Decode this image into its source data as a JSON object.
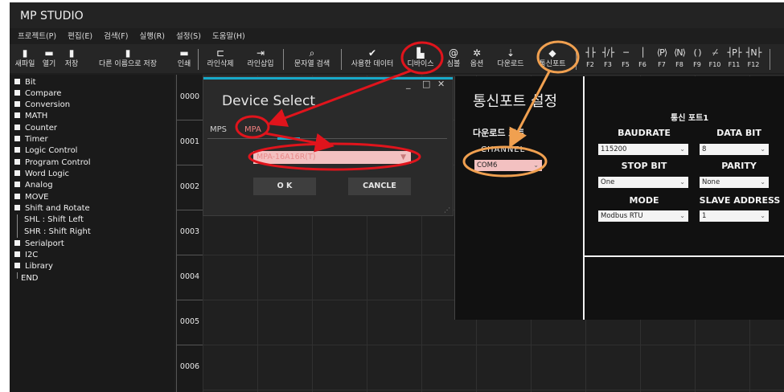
{
  "app": {
    "title": "MP STUDIO"
  },
  "menu": [
    "프로젝트(P)",
    "편집(E)",
    "검색(F)",
    "실행(R)",
    "설정(S)",
    "도움말(H)"
  ],
  "toolbar": {
    "buttons": [
      {
        "label": "새파일",
        "icon": "new-file-icon"
      },
      {
        "label": "열기",
        "icon": "open-folder-icon"
      },
      {
        "label": "저장",
        "icon": "save-icon"
      },
      {
        "label": "다른 이름으로 저장",
        "icon": "save-as-icon"
      },
      {
        "label": "인쇄",
        "icon": "print-icon"
      },
      {
        "label": "라인삭제",
        "icon": "delete-line-icon"
      },
      {
        "label": "라인삽입",
        "icon": "insert-line-icon"
      },
      {
        "label": "문자열 검색",
        "icon": "search-icon"
      },
      {
        "label": "사용한 데이터",
        "icon": "check-icon"
      },
      {
        "label": "디바이스",
        "icon": "device-icon"
      },
      {
        "label": "심볼",
        "icon": "at-symbol-icon"
      },
      {
        "label": "옵션",
        "icon": "gear-icon"
      },
      {
        "label": "다운로드",
        "icon": "download-icon"
      },
      {
        "label": "통신포트",
        "icon": "comm-port-icon"
      }
    ],
    "fkeys": [
      "F2",
      "F3",
      "F5",
      "F6",
      "F7",
      "F8",
      "F9",
      "F10",
      "F11",
      "F12"
    ]
  },
  "tree": {
    "items": [
      "Bit",
      "Compare",
      "Conversion",
      "MATH",
      "Counter",
      "Timer",
      "Logic Control",
      "Program Control",
      "Word Logic",
      "Analog",
      "MOVE",
      "Shift and Rotate"
    ],
    "sub_items": [
      "SHL : Shift Left",
      "SHR : Shift Right"
    ],
    "items2": [
      "Serialport",
      "I2C",
      "Library"
    ],
    "end": "END"
  },
  "rungs": [
    "0000",
    "0001",
    "0002",
    "0003",
    "0004",
    "0005",
    "0006"
  ],
  "device_dialog": {
    "title": "Device Select",
    "controls": {
      "minimize": "_",
      "maximize": "□",
      "close": "✕"
    },
    "tabs": [
      "MPS",
      "MPA"
    ],
    "selected_tab": "MPA",
    "device_value": "MPA-16A16R(T)",
    "ok_label": "O K",
    "cancel_label": "CANCLE"
  },
  "comm_panel": {
    "title": "통신포트 설정",
    "download_port_label": "다운로드 포트",
    "channel_label": "CHANNEL",
    "channel_value": "COM6",
    "section_title": "통신 포트1",
    "baudrate_label": "BAUDRATE",
    "baudrate_value": "115200",
    "databit_label": "DATA BIT",
    "databit_value": "8",
    "stopbit_label": "STOP BIT",
    "stopbit_value": "One",
    "parity_label": "PARITY",
    "parity_value": "None",
    "mode_label": "MODE",
    "mode_value": "Modbus RTU",
    "slave_label": "SLAVE ADDRESS",
    "slave_value": "1"
  },
  "annotation_colors": {
    "red": "#e0141c",
    "orange": "#f0a050"
  }
}
